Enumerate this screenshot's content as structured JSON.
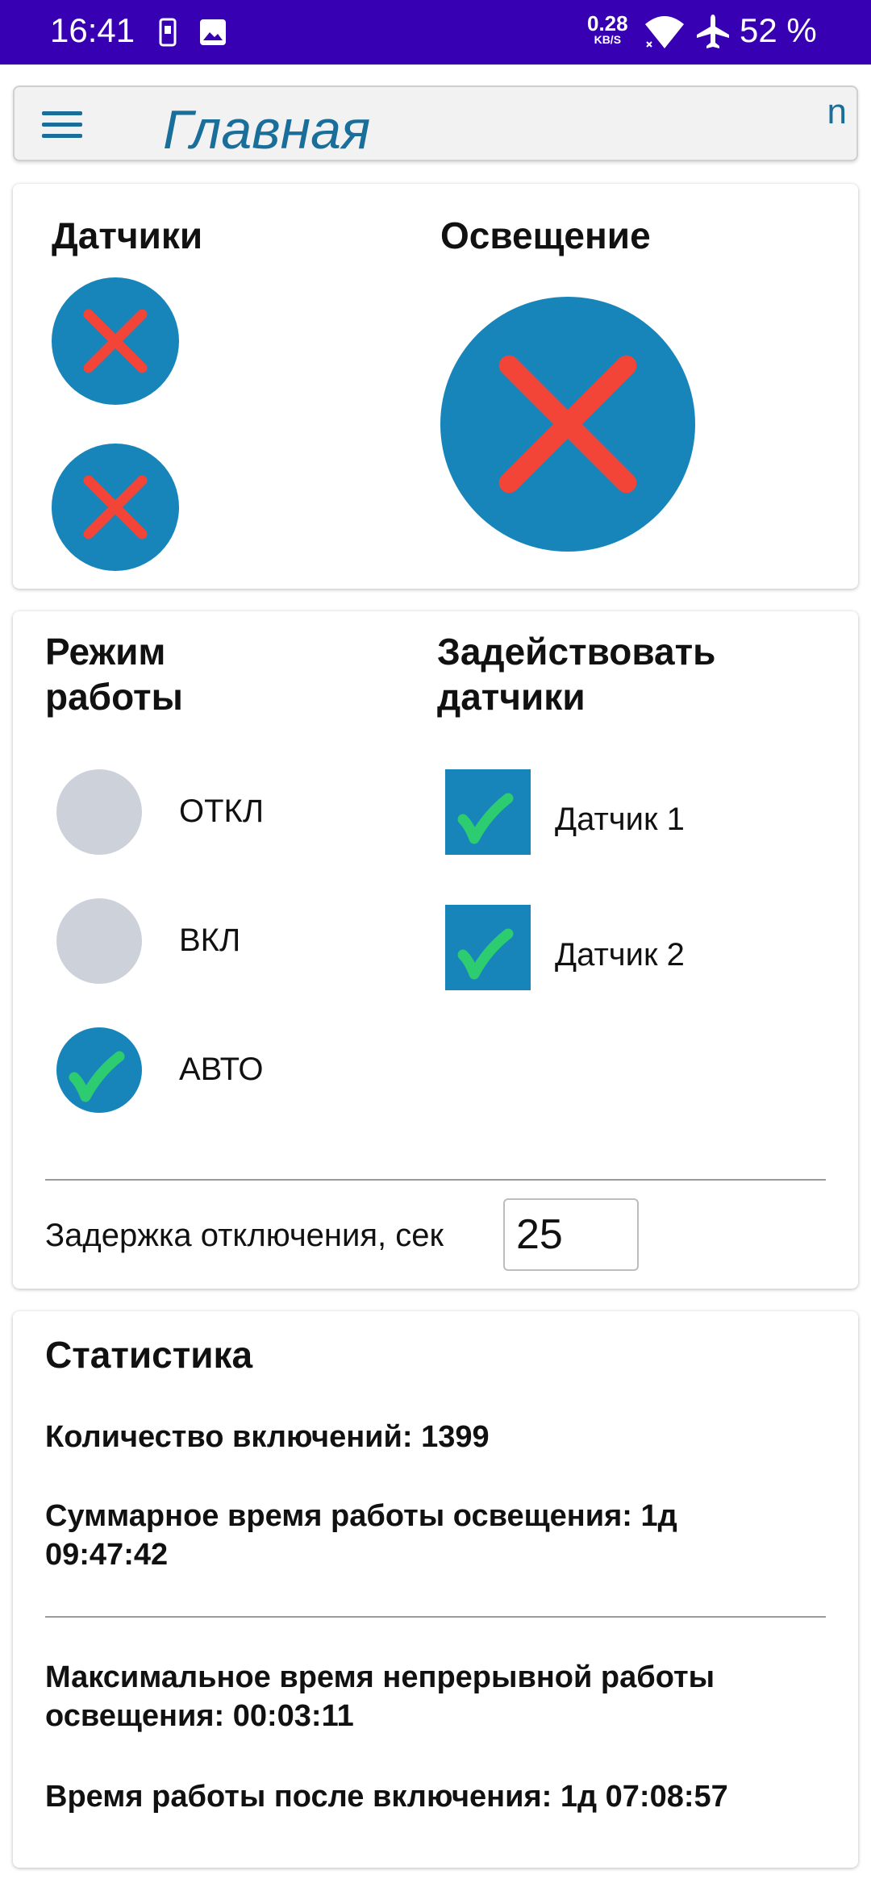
{
  "status_bar": {
    "time": "16:41",
    "net_speed": "0.28",
    "net_unit": "KB/S",
    "battery": "52 %"
  },
  "app_bar": {
    "title": "Главная",
    "corner_text": "n"
  },
  "indicators": {
    "sensors_title": "Датчики",
    "lighting_title": "Освещение",
    "sensor_states": [
      "off",
      "off"
    ],
    "lighting_state": "off"
  },
  "mode": {
    "title_line1": "Режим",
    "title_line2": "работы",
    "options": [
      {
        "label": "ОТКЛ",
        "checked": false
      },
      {
        "label": "ВКЛ",
        "checked": false
      },
      {
        "label": "АВТО",
        "checked": true
      }
    ]
  },
  "sensors_use": {
    "title_line1": "Задействовать",
    "title_line2": "датчики",
    "items": [
      {
        "label": "Датчик 1",
        "checked": true
      },
      {
        "label": "Датчик 2",
        "checked": true
      }
    ]
  },
  "delay": {
    "label": "Задержка отключения, сек",
    "value": "25"
  },
  "stats": {
    "title": "Статистика",
    "count": "Количество включений: 1399",
    "total_time_line1": "Суммарное время работы освещения: 1д",
    "total_time_line2": "09:47:42",
    "max_time_line1": "Максимальное время непрерывной работы",
    "max_time_line2": "освещения: 00:03:11",
    "uptime": "Время работы после включения: 1д 07:08:57"
  },
  "colors": {
    "status_bar": "#3700b3",
    "accent": "#1785ba",
    "title": "#1a6e9a",
    "cross": "#f24437",
    "check": "#2ecc71",
    "radio_off": "#cdd2da"
  }
}
